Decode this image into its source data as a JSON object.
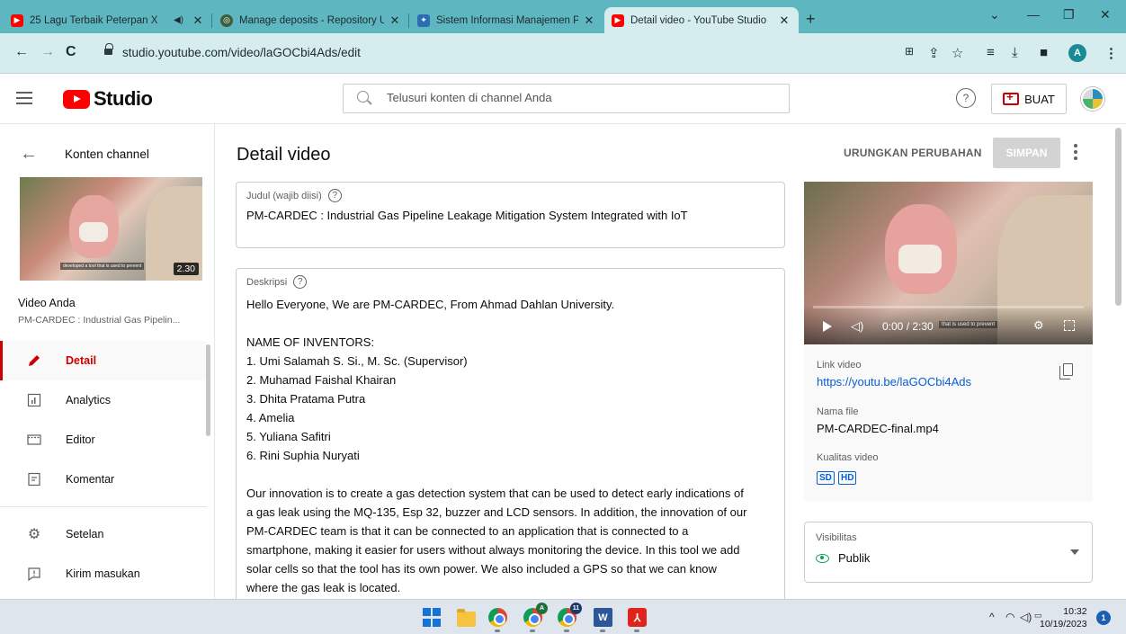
{
  "browser": {
    "tabs": [
      {
        "title": "25 Lagu Terbaik Peterpan X",
        "favicon": "youtube-icon",
        "active": false
      },
      {
        "title": "Manage deposits - Repository U",
        "favicon": "repository-icon",
        "active": false
      },
      {
        "title": "Sistem Informasi Manajemen PA",
        "favicon": "sim-icon",
        "active": false
      },
      {
        "title": "Detail video - YouTube Studio",
        "favicon": "youtube-icon",
        "active": true
      }
    ],
    "url": "studio.youtube.com/video/laGOCbi4Ads/edit",
    "profile_initial": "A"
  },
  "studio": {
    "logo_text": "Studio",
    "search_placeholder": "Telusuri konten di channel Anda",
    "create_label": "BUAT"
  },
  "sidebar": {
    "back_label": "Konten channel",
    "thumb_duration": "2.30",
    "thumb_caption": "developed a tool that is used to prevent",
    "video_label": "Video Anda",
    "video_subtitle": "PM-CARDEC : Industrial Gas Pipelin...",
    "items": [
      {
        "label": "Detail",
        "icon": "pencil-icon",
        "active": true
      },
      {
        "label": "Analytics",
        "icon": "analytics-icon",
        "active": false
      },
      {
        "label": "Editor",
        "icon": "editor-icon",
        "active": false
      },
      {
        "label": "Komentar",
        "icon": "comment-icon",
        "active": false
      }
    ],
    "bottom_items": [
      {
        "label": "Setelan",
        "icon": "settings-icon"
      },
      {
        "label": "Kirim masukan",
        "icon": "feedback-icon"
      }
    ]
  },
  "main": {
    "title": "Detail video",
    "undo_label": "URUNGKAN PERUBAHAN",
    "save_label": "SIMPAN",
    "title_field": {
      "label": "Judul (wajib diisi)",
      "value": "PM-CARDEC : Industrial Gas Pipeline Leakage Mitigation System Integrated with IoT"
    },
    "description_field": {
      "label": "Deskripsi",
      "intro": "Hello Everyone, We are PM-CARDEC, From Ahmad Dahlan University.",
      "inventors_heading": "NAME OF INVENTORS:",
      "inventors": [
        "1. Umi Salamah S. Si., M. Sc. (Supervisor)",
        "2. Muhamad Faishal Khairan",
        "3. Dhita Pratama Putra",
        "4. Amelia",
        "5. Yuliana Safitri",
        "6. Rini Suphia Nuryati"
      ],
      "body_lines": [
        "Our innovation is to create a gas detection system that can be used to detect early  indications of",
        "a gas leak using the MQ-135, Esp 32, buzzer and LCD sensors. In addition, the  innovation of our",
        "PM-CARDEC team is that it can be connected to an application that is  connected to a",
        "smartphone, making it easier for users without always monitoring the device. In this tool we add",
        "solar cells so that the tool has its own power. We also included a GPS so that we can know",
        "where the gas leak is located."
      ]
    }
  },
  "panel": {
    "player_time": "0:00 / 2:30",
    "player_caption": "that is used to prevent",
    "link_label": "Link video",
    "link_value": "https://youtu.be/laGOCbi4Ads",
    "file_label": "Nama file",
    "file_value": "PM-CARDEC-final.mp4",
    "quality_label": "Kualitas video",
    "quality_badges": [
      "SD",
      "HD"
    ],
    "visibility_label": "Visibilitas",
    "visibility_value": "Publik"
  },
  "taskbar": {
    "chrome_badge": "A",
    "chrome2_badge": "11",
    "clock_time": "10:32",
    "clock_date": "10/19/2023",
    "notification_count": "1"
  },
  "colors": {
    "tabbar": "#5eb7c0",
    "toolbar": "#d6edf0",
    "accent_red": "#cc0000",
    "link_blue": "#065fd4"
  }
}
